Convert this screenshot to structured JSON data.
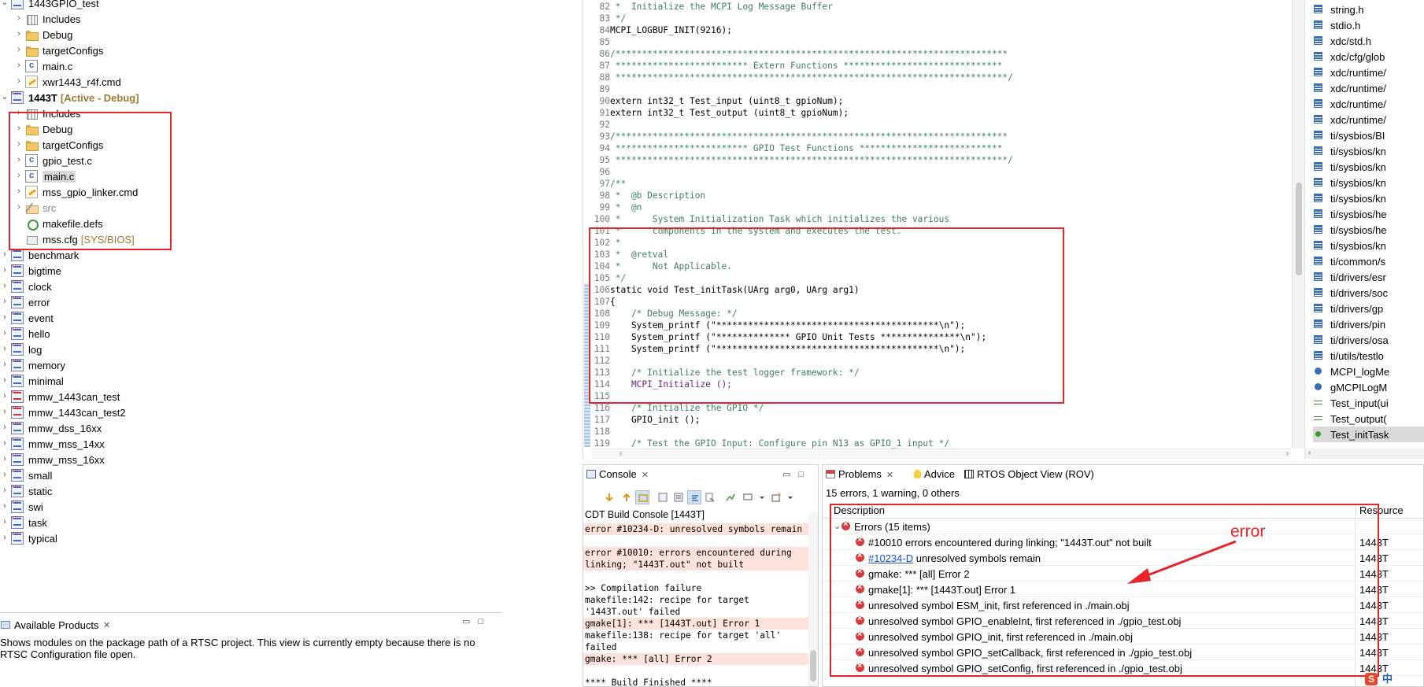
{
  "explorer": {
    "items": [
      {
        "label": "1443GPIO_test",
        "deco": ""
      },
      {
        "label": "Includes",
        "deco": ""
      },
      {
        "label": "Debug",
        "deco": ""
      },
      {
        "label": "targetConfigs",
        "deco": ""
      },
      {
        "label": "main.c",
        "deco": ""
      },
      {
        "label": "xwr1443_r4f.cmd",
        "deco": ""
      },
      {
        "label": "1443T",
        "deco": "[Active - Debug]"
      },
      {
        "label": "Includes",
        "deco": ""
      },
      {
        "label": "Debug",
        "deco": ""
      },
      {
        "label": "targetConfigs",
        "deco": ""
      },
      {
        "label": "gpio_test.c",
        "deco": ""
      },
      {
        "label": "main.c",
        "deco": ""
      },
      {
        "label": "mss_gpio_linker.cmd",
        "deco": ""
      },
      {
        "label": "src",
        "deco": ""
      },
      {
        "label": "makefile.defs",
        "deco": ""
      },
      {
        "label": "mss.cfg",
        "deco": "[SYS/BIOS]"
      },
      {
        "label": "benchmark",
        "deco": ""
      },
      {
        "label": "bigtime",
        "deco": ""
      },
      {
        "label": "clock",
        "deco": ""
      },
      {
        "label": "error",
        "deco": ""
      },
      {
        "label": "event",
        "deco": ""
      },
      {
        "label": "hello",
        "deco": ""
      },
      {
        "label": "log",
        "deco": ""
      },
      {
        "label": "memory",
        "deco": ""
      },
      {
        "label": "minimal",
        "deco": ""
      },
      {
        "label": "mmw_1443can_test",
        "deco": ""
      },
      {
        "label": "mmw_1443can_test2",
        "deco": ""
      },
      {
        "label": "mmw_dss_16xx",
        "deco": ""
      },
      {
        "label": "mmw_mss_14xx",
        "deco": ""
      },
      {
        "label": "mmw_mss_16xx",
        "deco": ""
      },
      {
        "label": "small",
        "deco": ""
      },
      {
        "label": "static",
        "deco": ""
      },
      {
        "label": "swi",
        "deco": ""
      },
      {
        "label": "task",
        "deco": ""
      },
      {
        "label": "typical",
        "deco": ""
      }
    ]
  },
  "products": {
    "title": "Available Products",
    "message": "Shows modules on the package path of a RTSC project. This view is currently empty because there is no RTSC Configuration file open."
  },
  "editor": {
    "lines": [
      {
        "n": "82",
        "t": " *  Initialize the MCPI Log Message Buffer"
      },
      {
        "n": "83",
        "t": " */"
      },
      {
        "n": "84",
        "t": "MCPI_LOGBUF_INIT(9216);"
      },
      {
        "n": "85",
        "t": ""
      },
      {
        "n": "86",
        "t": "/**************************************************************************"
      },
      {
        "n": "87",
        "t": " ************************* Extern Functions ******************************"
      },
      {
        "n": "88",
        "t": " **************************************************************************/"
      },
      {
        "n": "89",
        "t": ""
      },
      {
        "n": "90",
        "t": "extern int32_t Test_input (uint8_t gpioNum);"
      },
      {
        "n": "91",
        "t": "extern int32_t Test_output (uint8_t gpioNum);"
      },
      {
        "n": "92",
        "t": ""
      },
      {
        "n": "93",
        "t": "/**************************************************************************"
      },
      {
        "n": "94",
        "t": " ************************* GPIO Test Functions ***************************"
      },
      {
        "n": "95",
        "t": " **************************************************************************/"
      },
      {
        "n": "96",
        "t": ""
      },
      {
        "n": "97",
        "t": "/**"
      },
      {
        "n": "98",
        "t": " *  @b Description"
      },
      {
        "n": "99",
        "t": " *  @n"
      },
      {
        "n": "100",
        "t": " *      System Initialization Task which initializes the various"
      },
      {
        "n": "101",
        "t": " *      components in the system and executes the test."
      },
      {
        "n": "102",
        "t": " *"
      },
      {
        "n": "103",
        "t": " *  @retval"
      },
      {
        "n": "104",
        "t": " *      Not Applicable."
      },
      {
        "n": "105",
        "t": " */"
      },
      {
        "n": "106",
        "t": "static void Test_initTask(UArg arg0, UArg arg1)"
      },
      {
        "n": "107",
        "t": "{"
      },
      {
        "n": "108",
        "t": "    /* Debug Message: */"
      },
      {
        "n": "109",
        "t": "    System_printf (\"******************************************\\n\");"
      },
      {
        "n": "110",
        "t": "    System_printf (\"************** GPIO Unit Tests ***************\\n\");"
      },
      {
        "n": "111",
        "t": "    System_printf (\"******************************************\\n\");"
      },
      {
        "n": "112",
        "t": ""
      },
      {
        "n": "113",
        "t": "    /* Initialize the test logger framework: */"
      },
      {
        "n": "114",
        "t": "    MCPI_Initialize ();"
      },
      {
        "n": "115",
        "t": ""
      },
      {
        "n": "116",
        "t": "    /* Initialize the GPIO */"
      },
      {
        "n": "117",
        "t": "    GPIO_init ();"
      },
      {
        "n": "118",
        "t": ""
      },
      {
        "n": "119",
        "t": "    /* Test the GPIO Input: Configure pin N13 as GPIO_1 input */"
      }
    ]
  },
  "outline": {
    "items": [
      {
        "label": "string.h",
        "kind": "inc"
      },
      {
        "label": "stdio.h",
        "kind": "inc"
      },
      {
        "label": "xdc/std.h",
        "kind": "inc"
      },
      {
        "label": "xdc/cfg/glob",
        "kind": "inc"
      },
      {
        "label": "xdc/runtime/",
        "kind": "inc"
      },
      {
        "label": "xdc/runtime/",
        "kind": "inc"
      },
      {
        "label": "xdc/runtime/",
        "kind": "inc"
      },
      {
        "label": "xdc/runtime/",
        "kind": "inc"
      },
      {
        "label": "ti/sysbios/BI",
        "kind": "inc"
      },
      {
        "label": "ti/sysbios/kn",
        "kind": "inc"
      },
      {
        "label": "ti/sysbios/kn",
        "kind": "inc"
      },
      {
        "label": "ti/sysbios/kn",
        "kind": "inc"
      },
      {
        "label": "ti/sysbios/kn",
        "kind": "inc"
      },
      {
        "label": "ti/sysbios/he",
        "kind": "inc"
      },
      {
        "label": "ti/sysbios/he",
        "kind": "inc"
      },
      {
        "label": "ti/sysbios/kn",
        "kind": "inc"
      },
      {
        "label": "ti/common/s",
        "kind": "inc"
      },
      {
        "label": "ti/drivers/esr",
        "kind": "inc"
      },
      {
        "label": "ti/drivers/soc",
        "kind": "inc"
      },
      {
        "label": "ti/drivers/gp",
        "kind": "inc"
      },
      {
        "label": "ti/drivers/pin",
        "kind": "inc"
      },
      {
        "label": "ti/drivers/osa",
        "kind": "inc"
      },
      {
        "label": "ti/utils/testlo",
        "kind": "inc"
      },
      {
        "label": "MCPI_logMe",
        "kind": "var"
      },
      {
        "label": "gMCPILogM",
        "kind": "var"
      },
      {
        "label": "Test_input(ui",
        "kind": "fn"
      },
      {
        "label": "Test_output(",
        "kind": "fn"
      },
      {
        "label": "Test_initTask",
        "kind": "sfn"
      }
    ]
  },
  "console": {
    "tab": "Console",
    "title": "CDT Build Console [1443T]",
    "lines": [
      {
        "t": "error #10234-D: unresolved symbols remain",
        "err": true
      },
      {
        "t": "error #10010: errors encountered during linking; \"1443T.out\" not built",
        "err": true
      },
      {
        "t": "",
        "err": false
      },
      {
        "t": ">> Compilation failure",
        "err": false
      },
      {
        "t": "makefile:142: recipe for target '1443T.out' failed",
        "err": false
      },
      {
        "t": "gmake[1]: *** [1443T.out] Error 1",
        "err": true
      },
      {
        "t": "makefile:138: recipe for target 'all' failed",
        "err": false
      },
      {
        "t": "gmake: *** [all] Error 2",
        "err": true
      },
      {
        "t": "",
        "err": false
      },
      {
        "t": "**** Build Finished ****",
        "err": false
      }
    ]
  },
  "problems": {
    "tabs": [
      "Problems",
      "Advice",
      "RTOS Object View (ROV)"
    ],
    "summary": "15 errors, 1 warning, 0 others",
    "col_description": "Description",
    "col_resource": "Resource",
    "group_label": "Errors (15 items)",
    "rows": [
      {
        "pre": "",
        "link": "",
        "desc": "#10010 errors encountered during linking; \"1443T.out\" not built",
        "res": "1443T"
      },
      {
        "pre": "",
        "link": "#10234-D",
        "desc": " unresolved symbols remain",
        "res": "1443T"
      },
      {
        "pre": "",
        "link": "",
        "desc": "gmake: *** [all] Error 2",
        "res": "1443T"
      },
      {
        "pre": "",
        "link": "",
        "desc": "gmake[1]: *** [1443T.out] Error 1",
        "res": "1443T"
      },
      {
        "pre": "",
        "link": "",
        "desc": "unresolved symbol ESM_init, first referenced in ./main.obj",
        "res": "1443T"
      },
      {
        "pre": "",
        "link": "",
        "desc": "unresolved symbol GPIO_enableInt, first referenced in ./gpio_test.obj",
        "res": "1443T"
      },
      {
        "pre": "",
        "link": "",
        "desc": "unresolved symbol GPIO_init, first referenced in ./main.obj",
        "res": "1443T"
      },
      {
        "pre": "",
        "link": "",
        "desc": "unresolved symbol GPIO_setCallback, first referenced in ./gpio_test.obj",
        "res": "1443T"
      },
      {
        "pre": "",
        "link": "",
        "desc": "unresolved symbol GPIO_setConfig, first referenced in ./gpio_test.obj",
        "res": "1443T"
      }
    ]
  },
  "annotation": {
    "text": "error",
    "color": "#e8232a"
  },
  "ime": {
    "glyph_s": "S",
    "glyph_zh": "中"
  }
}
